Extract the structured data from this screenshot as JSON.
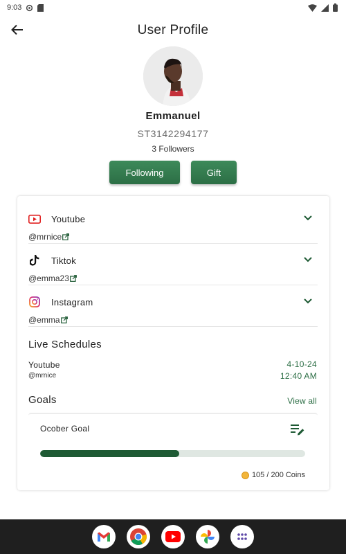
{
  "status_bar": {
    "time": "9:03"
  },
  "header": {
    "title": "User Profile"
  },
  "profile": {
    "name": "Emmanuel",
    "id": "ST3142294177",
    "followers": "3 Followers"
  },
  "actions": {
    "following_label": "Following",
    "gift_label": "Gift"
  },
  "socials": [
    {
      "platform": "Youtube",
      "handle": "@mrnice",
      "icon": "youtube-icon"
    },
    {
      "platform": "Tiktok",
      "handle": "@emma23",
      "icon": "tiktok-icon"
    },
    {
      "platform": "Instagram",
      "handle": "@emma",
      "icon": "instagram-icon"
    }
  ],
  "live_schedules": {
    "title": "Live Schedules",
    "items": [
      {
        "platform": "Youtube",
        "handle": "@mrnice",
        "date": "4-10-24",
        "time": "12:40 AM"
      }
    ]
  },
  "goals": {
    "title": "Goals",
    "view_all": "View all",
    "items": [
      {
        "name": "Ocober Goal",
        "current": 105,
        "target": 200,
        "progress_fraction": 0.525,
        "coins_label": "105 / 200 Coins"
      }
    ]
  },
  "colors": {
    "accent": "#2c6e45",
    "progress": "#1e5a34",
    "dock": "#1f1f1f"
  },
  "dock_apps": [
    "gmail-icon",
    "chrome-icon",
    "youtube-app-icon",
    "photos-icon",
    "app-drawer-icon"
  ]
}
